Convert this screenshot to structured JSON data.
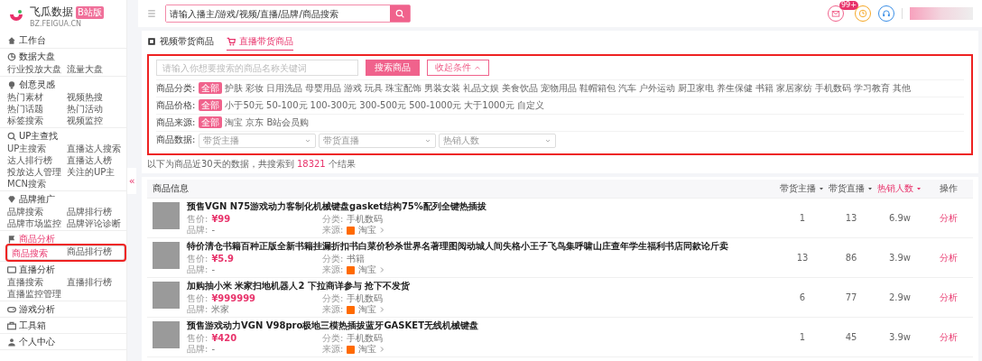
{
  "logo": {
    "name": "飞瓜数据",
    "badge": "B站版",
    "domain": "BZ.FEIGUA.CN"
  },
  "header": {
    "search_placeholder": "请输入播主/游戏/视频/直播/品牌/商品搜索",
    "notification_badge": "99+"
  },
  "sidebar": {
    "sections": [
      {
        "label": "工作台",
        "active": false
      },
      {
        "label": "数据大盘",
        "active": false,
        "items": [
          {
            "label": "行业投放大盘",
            "selected": false
          },
          {
            "label": "流量大盘",
            "selected": false
          }
        ]
      },
      {
        "label": "创意灵感",
        "active": false,
        "items": [
          {
            "label": "热门素材",
            "selected": false
          },
          {
            "label": "视频热搜",
            "selected": false
          },
          {
            "label": "热门话题",
            "selected": false
          },
          {
            "label": "热门活动",
            "selected": false
          },
          {
            "label": "标签搜索",
            "selected": false
          },
          {
            "label": "视频监控",
            "selected": false
          }
        ]
      },
      {
        "label": "UP主查找",
        "active": false,
        "items": [
          {
            "label": "UP主搜索",
            "selected": false
          },
          {
            "label": "直播达人搜索",
            "selected": false
          },
          {
            "label": "达人排行榜",
            "selected": false
          },
          {
            "label": "直播达人榜",
            "selected": false
          },
          {
            "label": "投放达人管理",
            "selected": false
          },
          {
            "label": "关注的UP主",
            "selected": false
          },
          {
            "label": "MCN搜索",
            "selected": false
          }
        ]
      },
      {
        "label": "品牌推广",
        "active": false,
        "items": [
          {
            "label": "品牌搜索",
            "selected": false
          },
          {
            "label": "品牌排行榜",
            "selected": false
          },
          {
            "label": "品牌市场监控",
            "selected": false
          },
          {
            "label": "品牌评论诊断",
            "selected": false
          }
        ]
      },
      {
        "label": "商品分析",
        "active": true,
        "items": [
          {
            "label": "商品搜索",
            "selected": true
          },
          {
            "label": "商品排行榜",
            "selected": false
          }
        ]
      },
      {
        "label": "直播分析",
        "active": false,
        "items": [
          {
            "label": "直播搜索",
            "selected": false
          },
          {
            "label": "直播排行榜",
            "selected": false
          },
          {
            "label": "直播监控管理",
            "selected": false
          }
        ]
      },
      {
        "label": "游戏分析",
        "active": false
      },
      {
        "label": "工具箱",
        "active": false
      },
      {
        "label": "个人中心",
        "active": false
      }
    ]
  },
  "sidebar_toggle": "«",
  "tabs": [
    {
      "label": "视频带货商品",
      "selected": false
    },
    {
      "label": "直播带货商品",
      "selected": true
    }
  ],
  "filters": {
    "search_placeholder": "请输入你想要搜索的商品名称关键词",
    "search_button": "搜索商品",
    "collapse_button": "收起条件",
    "rows": [
      {
        "label": "商品分类:",
        "kind": "options",
        "options": [
          {
            "label": "全部",
            "selected": true
          },
          {
            "label": "护肤",
            "selected": false
          },
          {
            "label": "彩妆",
            "selected": false
          },
          {
            "label": "日用洗品",
            "selected": false
          },
          {
            "label": "母婴用品",
            "selected": false
          },
          {
            "label": "游戏",
            "selected": false
          },
          {
            "label": "玩具",
            "selected": false
          },
          {
            "label": "珠宝配饰",
            "selected": false
          },
          {
            "label": "男装女装",
            "selected": false
          },
          {
            "label": "礼品文娱",
            "selected": false
          },
          {
            "label": "美食饮品",
            "selected": false
          },
          {
            "label": "宠物用品",
            "selected": false
          },
          {
            "label": "鞋帽箱包",
            "selected": false
          },
          {
            "label": "汽车",
            "selected": false
          },
          {
            "label": "户外运动",
            "selected": false
          },
          {
            "label": "厨卫家电",
            "selected": false
          },
          {
            "label": "养生保健",
            "selected": false
          },
          {
            "label": "书籍",
            "selected": false
          },
          {
            "label": "家居家纺",
            "selected": false
          },
          {
            "label": "手机数码",
            "selected": false
          },
          {
            "label": "学习教育",
            "selected": false
          },
          {
            "label": "其他",
            "selected": false
          }
        ]
      },
      {
        "label": "商品价格:",
        "kind": "options",
        "options": [
          {
            "label": "全部",
            "selected": true
          },
          {
            "label": "小于50元",
            "selected": false
          },
          {
            "label": "50-100元",
            "selected": false
          },
          {
            "label": "100-300元",
            "selected": false
          },
          {
            "label": "300-500元",
            "selected": false
          },
          {
            "label": "500-1000元",
            "selected": false
          },
          {
            "label": "大于1000元",
            "selected": false
          },
          {
            "label": "自定义",
            "selected": false
          }
        ]
      },
      {
        "label": "商品来源:",
        "kind": "options",
        "options": [
          {
            "label": "全部",
            "selected": true
          },
          {
            "label": "淘宝",
            "selected": false
          },
          {
            "label": "京东",
            "selected": false
          },
          {
            "label": "B站会员购",
            "selected": false
          }
        ]
      },
      {
        "label": "商品数据:",
        "kind": "selects",
        "selects": [
          {
            "placeholder": "带货主播"
          },
          {
            "placeholder": "带货直播"
          },
          {
            "placeholder": "热销人数"
          }
        ]
      }
    ]
  },
  "result_note": "以下为商品近30天的数据，共搜索到 **18321** 个结果",
  "table": {
    "columns": [
      {
        "label": "商品信息",
        "sortable": false,
        "sorted": false
      },
      {
        "label": "带货主播",
        "sortable": true,
        "sorted": false
      },
      {
        "label": "带货直播",
        "sortable": true,
        "sorted": false
      },
      {
        "label": "热销人数",
        "sortable": true,
        "sorted": true
      },
      {
        "label": "操作",
        "sortable": false,
        "sorted": false
      }
    ],
    "rows": [
      {
        "title": "预售VGN N75游戏动力客制化机械键盘gasket结构75%配列全键热插拔",
        "price_label": "售价:",
        "price": "¥99",
        "category_label": "分类:",
        "category": "手机数码",
        "brand_label": "品牌:",
        "brand": "-",
        "source_label": "来源:",
        "source": "淘宝",
        "hosts": "1",
        "streams": "13",
        "sold": "6.9w",
        "action": "分析"
      },
      {
        "title": "特价清仓书籍百种正版全新书籍挂漏折扣书白菜价秒杀世界名著理图阅动城人间失格小王子飞鸟集呼啸山庄查年学生福利书店同款论斤卖",
        "price_label": "售价:",
        "price": "¥5.9",
        "category_label": "分类:",
        "category": "书籍",
        "brand_label": "品牌:",
        "brand": "-",
        "source_label": "来源:",
        "source": "淘宝",
        "hosts": "13",
        "streams": "86",
        "sold": "3.9w",
        "action": "分析"
      },
      {
        "title": "加购抽小米 米家扫地机器人2 下拉商详参与 抢下不发货",
        "price_label": "售价:",
        "price": "¥999999",
        "category_label": "分类:",
        "category": "手机数码",
        "brand_label": "品牌:",
        "brand": "米家",
        "source_label": "来源:",
        "source": "淘宝",
        "hosts": "6",
        "streams": "77",
        "sold": "2.9w",
        "action": "分析"
      },
      {
        "title": "预售游戏动力VGN V98pro极地三模热插拔蓝牙GASKET无线机械键盘",
        "price_label": "售价:",
        "price": "¥420",
        "category_label": "分类:",
        "category": "手机数码",
        "brand_label": "品牌:",
        "brand": "-",
        "source_label": "来源:",
        "source": "淘宝",
        "hosts": "1",
        "streams": "45",
        "sold": "3.9w",
        "action": "分析"
      }
    ]
  }
}
